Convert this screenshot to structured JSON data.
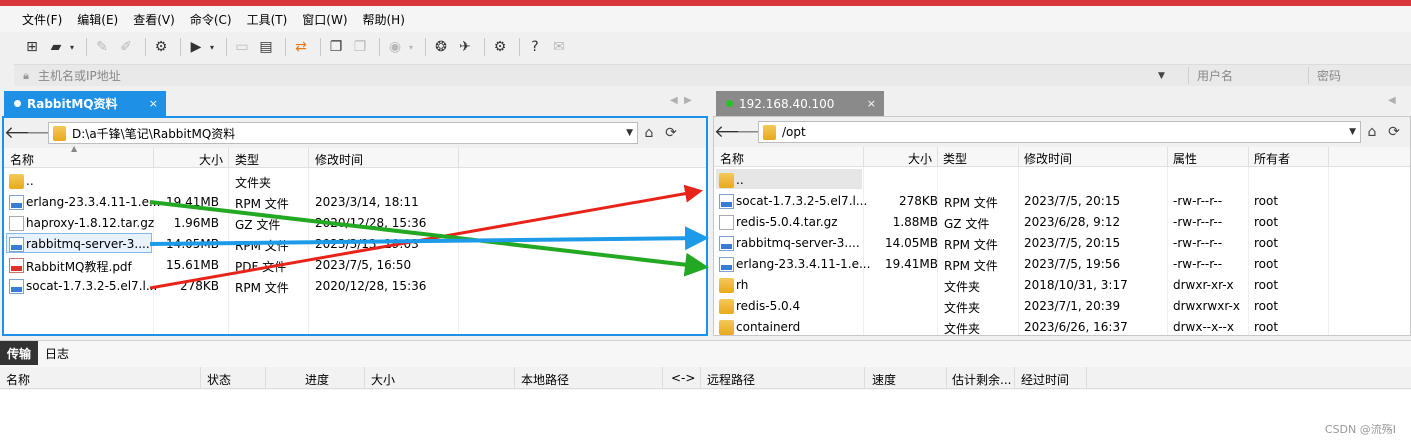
{
  "menu": [
    "文件(F)",
    "编辑(E)",
    "查看(V)",
    "命令(C)",
    "工具(T)",
    "窗口(W)",
    "帮助(H)"
  ],
  "toolbar_icons": [
    "new-session-icon",
    "open-folder-icon",
    "disconnect-icon",
    "reconnect-icon",
    "session-settings-icon",
    "terminal-icon",
    "copy-file-icon",
    "paste-file-icon",
    "transfer-icon",
    "clipboard-icon",
    "clipboard-dim-icon",
    "globe-icon",
    "xshell-icon",
    "xftp-icon",
    "gear-icon",
    "help-icon",
    "chat-icon"
  ],
  "address": {
    "host_placeholder": "主机名或IP地址",
    "user_placeholder": "用户名",
    "pass_placeholder": "密码"
  },
  "left_tab": {
    "label": "RabbitMQ资料",
    "dot_color": "#ffffff"
  },
  "right_tab": {
    "label": "192.168.40.100",
    "dot_color": "#22c422"
  },
  "left_pane": {
    "path": "D:\\a千锋\\笔记\\RabbitMQ资料",
    "columns": [
      "名称",
      "大小",
      "类型",
      "修改时间"
    ],
    "files": [
      {
        "name": "..",
        "size": "",
        "type": "文件夹",
        "mtime": "",
        "icon": "folder"
      },
      {
        "name": "erlang-23.3.4.11-1.e...",
        "size": "19.41MB",
        "type": "RPM 文件",
        "mtime": "2023/3/14, 18:11",
        "icon": "rpm"
      },
      {
        "name": "haproxy-1.8.12.tar.gz",
        "size": "1.96MB",
        "type": "GZ 文件",
        "mtime": "2020/12/28, 15:36",
        "icon": "gz"
      },
      {
        "name": "rabbitmq-server-3....",
        "size": "14.05MB",
        "type": "RPM 文件",
        "mtime": "2023/3/13, 19:03",
        "icon": "rpm"
      },
      {
        "name": "RabbitMQ教程.pdf",
        "size": "15.61MB",
        "type": "PDF 文件",
        "mtime": "2023/7/5, 16:50",
        "icon": "pdf"
      },
      {
        "name": "socat-1.7.3.2-5.el7.l...",
        "size": "278KB",
        "type": "RPM 文件",
        "mtime": "2020/12/28, 15:36",
        "icon": "rpm"
      }
    ]
  },
  "right_pane": {
    "path": "/opt",
    "columns": [
      "名称",
      "大小",
      "类型",
      "修改时间",
      "属性",
      "所有者"
    ],
    "files": [
      {
        "name": "..",
        "size": "",
        "type": "",
        "mtime": "",
        "attr": "",
        "owner": "",
        "icon": "folder"
      },
      {
        "name": "socat-1.7.3.2-5.el7.l...",
        "size": "278KB",
        "type": "RPM 文件",
        "mtime": "2023/7/5, 20:15",
        "attr": "-rw-r--r--",
        "owner": "root",
        "icon": "rpm"
      },
      {
        "name": "redis-5.0.4.tar.gz",
        "size": "1.88MB",
        "type": "GZ 文件",
        "mtime": "2023/6/28, 9:12",
        "attr": "-rw-r--r--",
        "owner": "root",
        "icon": "gz"
      },
      {
        "name": "rabbitmq-server-3....",
        "size": "14.05MB",
        "type": "RPM 文件",
        "mtime": "2023/7/5, 20:15",
        "attr": "-rw-r--r--",
        "owner": "root",
        "icon": "rpm"
      },
      {
        "name": "erlang-23.3.4.11-1.e...",
        "size": "19.41MB",
        "type": "RPM 文件",
        "mtime": "2023/7/5, 19:56",
        "attr": "-rw-r--r--",
        "owner": "root",
        "icon": "rpm"
      },
      {
        "name": "rh",
        "size": "",
        "type": "文件夹",
        "mtime": "2018/10/31, 3:17",
        "attr": "drwxr-xr-x",
        "owner": "root",
        "icon": "folder"
      },
      {
        "name": "redis-5.0.4",
        "size": "",
        "type": "文件夹",
        "mtime": "2023/7/1, 20:39",
        "attr": "drwxrwxr-x",
        "owner": "root",
        "icon": "folder"
      },
      {
        "name": "containerd",
        "size": "",
        "type": "文件夹",
        "mtime": "2023/6/26, 16:37",
        "attr": "drwx--x--x",
        "owner": "root",
        "icon": "folder"
      }
    ]
  },
  "bottom": {
    "tabs": [
      "传输",
      "日志"
    ],
    "columns": [
      "名称",
      "状态",
      "进度",
      "大小",
      "本地路径",
      "<->",
      "远程路径",
      "速度",
      "估计剩余...",
      "经过时间"
    ]
  },
  "annotation_arrows": [
    {
      "from": "socat-1.7.3.2-5.el7.l...",
      "to": "..",
      "color": "#e8231a"
    },
    {
      "from": "erlang-23.3.4.11-1.e...",
      "to": "erlang-23.3.4.11-1.e...",
      "color": "#22a822"
    },
    {
      "from": "rabbitmq-server-3....",
      "to": "rabbitmq-server-3....",
      "color": "#1e9be8"
    }
  ],
  "watermark": "CSDN @流殇I"
}
